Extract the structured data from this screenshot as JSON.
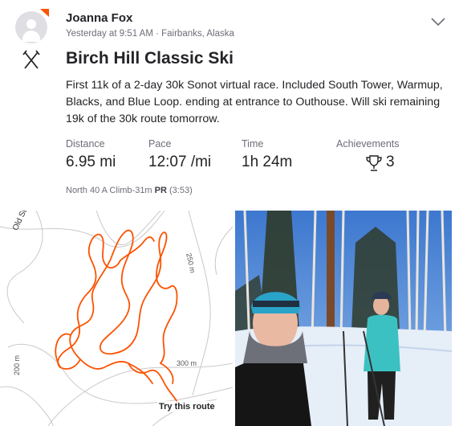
{
  "header": {
    "athlete_name": "Joanna Fox",
    "meta": "Yesterday at 9:51 AM · Fairbanks, Alaska"
  },
  "activity": {
    "sport_icon": "cross-country-ski-icon",
    "title": "Birch Hill Classic Ski",
    "description": "First 11k of a 2-day 30k Sonot virtual race. Included South Tower, Warmup, Blacks, and Blue Loop. ending at entrance to Outhouse. Will ski remaining 19k of the 30k route tomorrow."
  },
  "stats": {
    "distance": {
      "label": "Distance",
      "value": "6.95 mi"
    },
    "pace": {
      "label": "Pace",
      "value": "12:07 /mi"
    },
    "time": {
      "label": "Time",
      "value": "1h 24m"
    },
    "achievements": {
      "label": "Achievements",
      "value": "3"
    }
  },
  "segment": {
    "prefix": "North 40 A Climb-31m",
    "pr": "PR",
    "suffix": "(3:53)"
  },
  "map": {
    "road_label": "Old Steese",
    "contour_250": "250 m",
    "contour_300": "300 m",
    "contour_200": "200 m",
    "try_route": "Try this route",
    "route_color": "#fc5200"
  },
  "colors": {
    "accent": "#fc5200",
    "text": "#242428",
    "muted": "#6d6d78"
  }
}
